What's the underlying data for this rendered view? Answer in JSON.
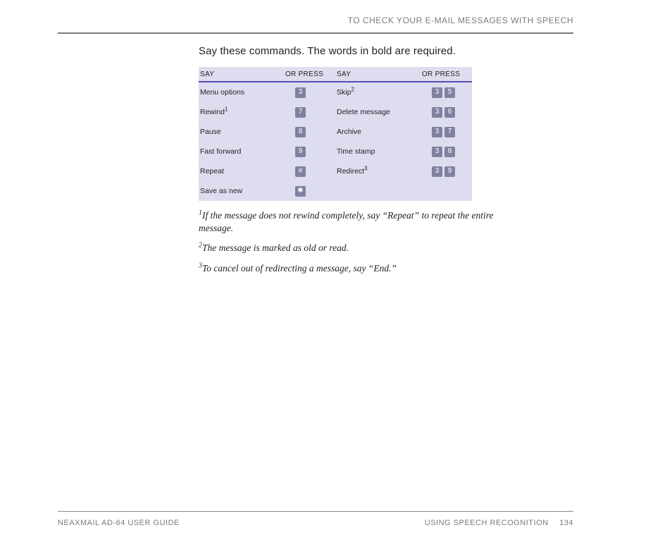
{
  "header": {
    "title": "TO CHECK YOUR E-MAIL MESSAGES WITH SPEECH"
  },
  "intro": "Say these commands. The words in bold are required.",
  "colheaders": {
    "say": "SAY",
    "press": "OR PRESS"
  },
  "left_rows": [
    {
      "say": "Menu options",
      "sup": "",
      "keys": [
        "3"
      ]
    },
    {
      "say": "Rewind",
      "sup": "1",
      "keys": [
        "7"
      ]
    },
    {
      "say": "Pause",
      "sup": "",
      "keys": [
        "8"
      ]
    },
    {
      "say": "Fast forward",
      "sup": "",
      "keys": [
        "9"
      ]
    },
    {
      "say": "Repeat",
      "sup": "",
      "keys": [
        "#"
      ]
    },
    {
      "say": "Save as new",
      "sup": "",
      "keys": [
        "✱"
      ]
    }
  ],
  "right_rows": [
    {
      "say": "Skip",
      "sup": "2",
      "keys": [
        "3",
        "5"
      ]
    },
    {
      "say": "Delete message",
      "sup": "",
      "keys": [
        "3",
        "6"
      ]
    },
    {
      "say": "Archive",
      "sup": "",
      "keys": [
        "3",
        "7"
      ]
    },
    {
      "say": "Time stamp",
      "sup": "",
      "keys": [
        "3",
        "8"
      ]
    },
    {
      "say": "Redirect",
      "sup": "3",
      "keys": [
        "3",
        "9"
      ]
    }
  ],
  "footnotes": {
    "f1": {
      "sup": "1",
      "text": "If the message does not rewind completely, say “Repeat” to repeat the entire message."
    },
    "f2": {
      "sup": "2",
      "text": "The message is marked as old or read."
    },
    "f3": {
      "sup": "3",
      "text": "To cancel out of redirecting a message, say “End.”"
    }
  },
  "footer": {
    "left": "NEAXMAIL AD-64 USER GUIDE",
    "right": "USING SPEECH RECOGNITION",
    "page": "134"
  }
}
